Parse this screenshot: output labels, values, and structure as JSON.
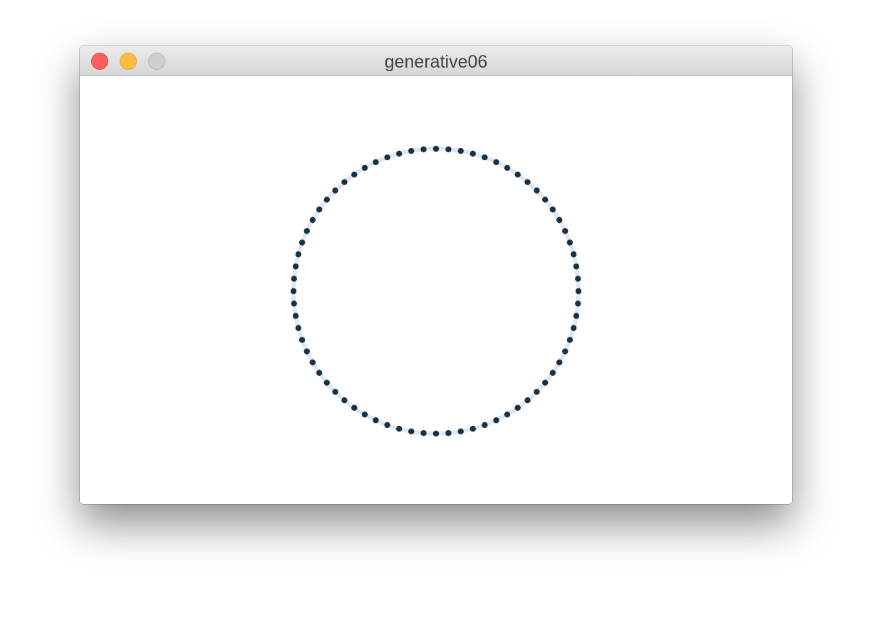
{
  "window": {
    "title": "generative06"
  },
  "sketch": {
    "ring_color": "#e4e8ee",
    "dot_color": "#163247",
    "dot_count": 72,
    "background": "#ffffff"
  }
}
